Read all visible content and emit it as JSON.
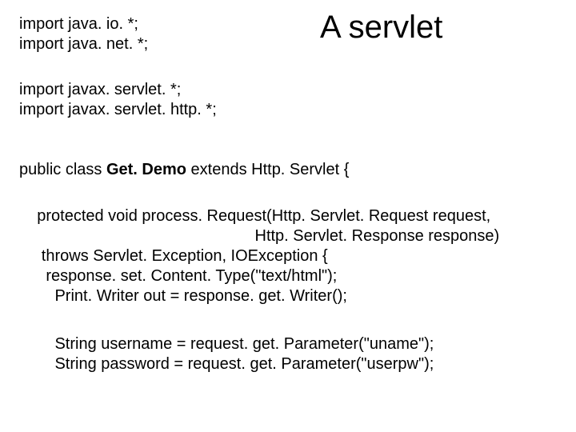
{
  "title": "A servlet",
  "code": {
    "imports1_l1": "import java. io. *;",
    "imports1_l2": "import java. net. *;",
    "imports2_l1": "import javax. servlet. *;",
    "imports2_l2": "import javax. servlet. http. *;",
    "class_pre": "public class ",
    "class_name": "Get. Demo",
    "class_post": " extends Http. Servlet {",
    "method_l1": "    protected void process. Request(Http. Servlet. Request request,",
    "method_l2": "                                                     Http. Servlet. Response response)",
    "method_l3": "     throws Servlet. Exception, IOException {",
    "method_l4": "      response. set. Content. Type(\"text/html\");",
    "method_l5": "        Print. Writer out = response. get. Writer();",
    "params_l1": "        String username = request. get. Parameter(\"uname\");",
    "params_l2": "        String password = request. get. Parameter(\"userpw\");"
  }
}
